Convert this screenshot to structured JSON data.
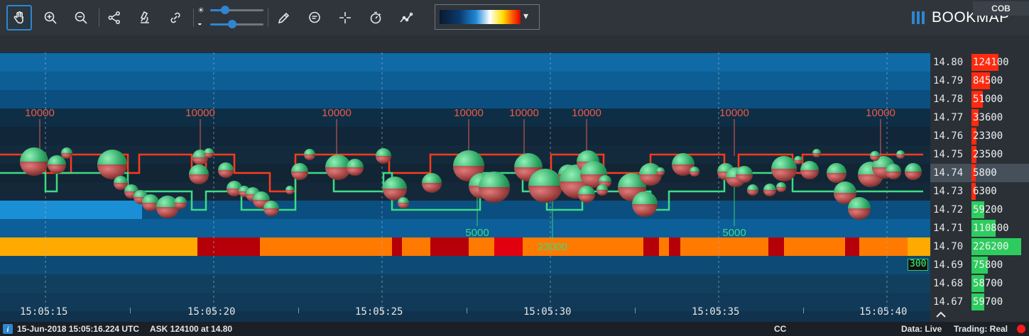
{
  "toolbar": {
    "tools": [
      "hand-tool",
      "zoom-in",
      "zoom-out",
      "share",
      "microscope",
      "link",
      "pencil",
      "chat",
      "crosshair",
      "timer",
      "line-chart"
    ],
    "brightness_level": 0.4,
    "contrast_level": 0.45,
    "colormap_dropdown_arrow": "▾"
  },
  "logo": {
    "text": "BOOKMAP"
  },
  "price_axis": {
    "cob_header": "COB",
    "rows": [
      {
        "price": "14.80",
        "cob": "124100",
        "side": "ask"
      },
      {
        "price": "14.79",
        "cob": "84500",
        "side": "ask"
      },
      {
        "price": "14.78",
        "cob": "51000",
        "side": "ask"
      },
      {
        "price": "14.77",
        "cob": "33600",
        "side": "ask"
      },
      {
        "price": "14.76",
        "cob": "23300",
        "side": "ask"
      },
      {
        "price": "14.75",
        "cob": "23500",
        "side": "ask"
      },
      {
        "price": "14.74",
        "cob": "5800",
        "side": "ask"
      },
      {
        "price": "14.73",
        "cob": "6300",
        "side": "ask"
      },
      {
        "price": "14.72",
        "cob": "59200",
        "side": "bid"
      },
      {
        "price": "14.71",
        "cob": "110800",
        "side": "bid"
      },
      {
        "price": "14.70",
        "cob": "226200",
        "side": "bid"
      },
      {
        "price": "14.69",
        "cob": "75800",
        "side": "bid"
      },
      {
        "price": "14.68",
        "cob": "58700",
        "side": "bid"
      },
      {
        "price": "14.67",
        "cob": "59700",
        "side": "bid"
      }
    ],
    "last_trade_badge": "300"
  },
  "time_axis": [
    "15:05:15",
    "15:05:20",
    "15:05:25",
    "15:05:30",
    "15:05:35",
    "15:05:40"
  ],
  "annotations": {
    "sell_labels": [
      "10000",
      "10000",
      "10000",
      "10000",
      "10000",
      "10000",
      "10000",
      "10000"
    ],
    "buy_labels": [
      "5000",
      "23000",
      "5000"
    ]
  },
  "status": {
    "datetime": "15-Jun-2018 15:05:16.224 UTC",
    "ask_info": "ASK 124100 at 14.80",
    "instrument": "CC",
    "data_mode": "Data: Live",
    "trading_mode": "Trading: Real"
  },
  "colors": {
    "accent": "#2e86d1",
    "ask_line": "#ff3a1a",
    "bid_line": "#3ddc84",
    "ask_bar": "#ff2a10",
    "bid_bar": "#2ecc5e",
    "status_dot": "#ff1a1a"
  }
}
